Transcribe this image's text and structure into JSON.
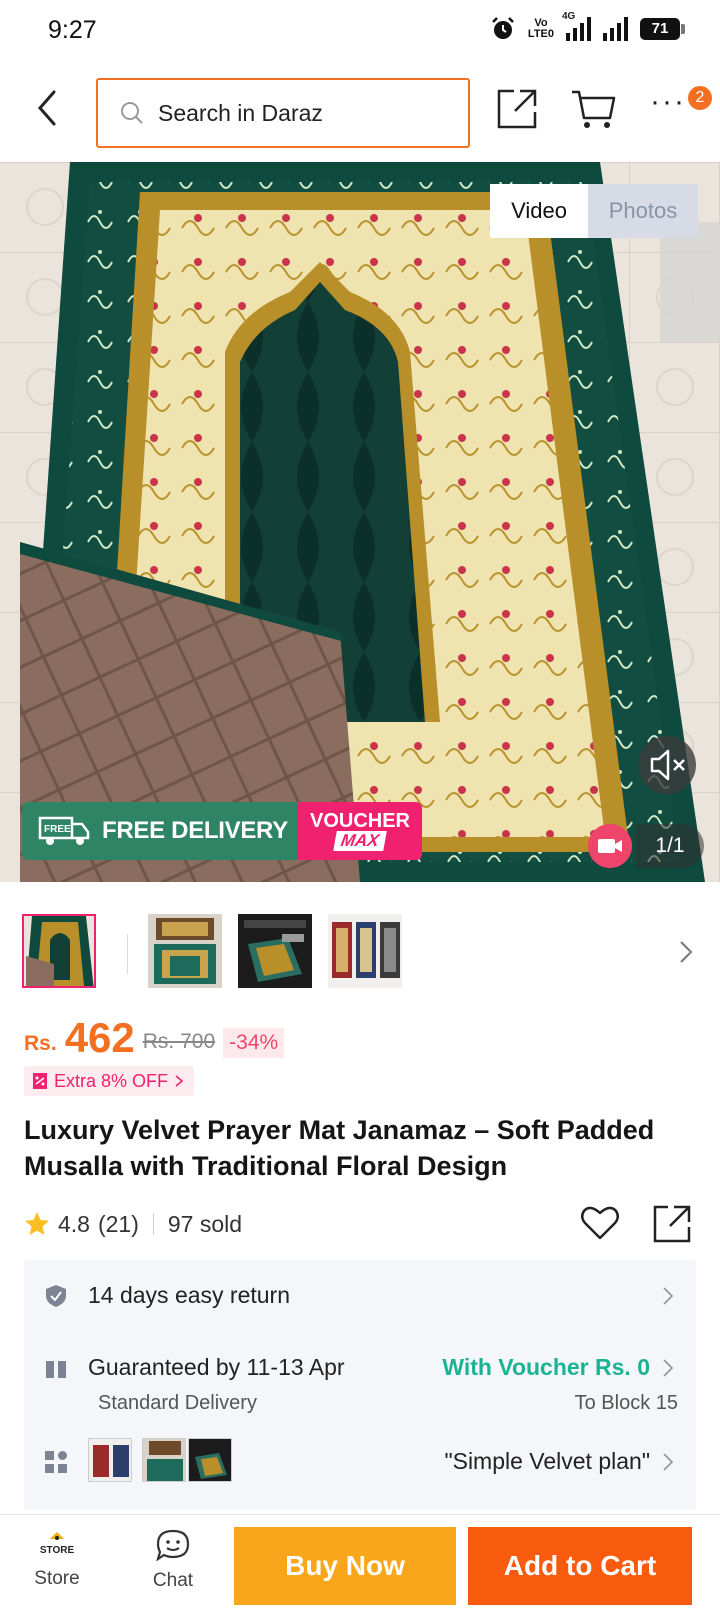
{
  "status_bar": {
    "time": "9:27",
    "network_top": "Vo",
    "network_bottom": "LTE0",
    "signal_label": "4G",
    "battery": "71"
  },
  "header": {
    "search_placeholder": "Search in Daraz",
    "cart_count": "2",
    "more_label": "···"
  },
  "gallery": {
    "tab_video": "Video",
    "tab_photos": "Photos",
    "page_indicator": "1/1",
    "promo_free_badge": "FREE",
    "promo_free_delivery": "FREE DELIVERY",
    "promo_voucher": "VOUCHER",
    "promo_voucher_sub": "MAX"
  },
  "product": {
    "currency": "Rs.",
    "price": "462",
    "original_price": "Rs. 700",
    "discount": "-34%",
    "extra_offer": "Extra 8% OFF",
    "title": "Luxury Velvet Prayer Mat Janamaz – Soft Padded Musalla with Traditional Floral Design",
    "rating": "4.8",
    "reviews": "(21)",
    "sold": "97 sold"
  },
  "info": {
    "return_label": "14 days easy return",
    "delivery_label": "Guaranteed by 11-13 Apr",
    "delivery_sub": "Standard Delivery",
    "voucher_label": "With Voucher Rs. 0",
    "location": "To Block 15",
    "variant_label": "\"Simple Velvet plan\""
  },
  "bottom_bar": {
    "store_label": "Store",
    "store_badge": "STORE",
    "chat_label": "Chat",
    "buy_now": "Buy Now",
    "add_to_cart": "Add to Cart"
  },
  "colors": {
    "accent": "#f36f21",
    "buy_now": "#faa61a",
    "add_to_cart": "#f85b0e",
    "voucher_green": "#1ab394",
    "discount_pink": "#f0216e",
    "rug_green": "#0f4a3f",
    "rug_gold": "#b98f2a"
  },
  "icons": {
    "back": "chevron-left-icon",
    "search": "search-icon",
    "share": "share-icon",
    "cart": "cart-icon",
    "more": "more-icon",
    "mute": "mute-icon",
    "video": "video-camera-icon",
    "star": "star-icon",
    "wishlist": "heart-icon",
    "return": "shield-check-icon",
    "delivery": "gift-box-icon",
    "variants": "grid-icon",
    "chat": "chat-icon",
    "store": "store-icon"
  }
}
